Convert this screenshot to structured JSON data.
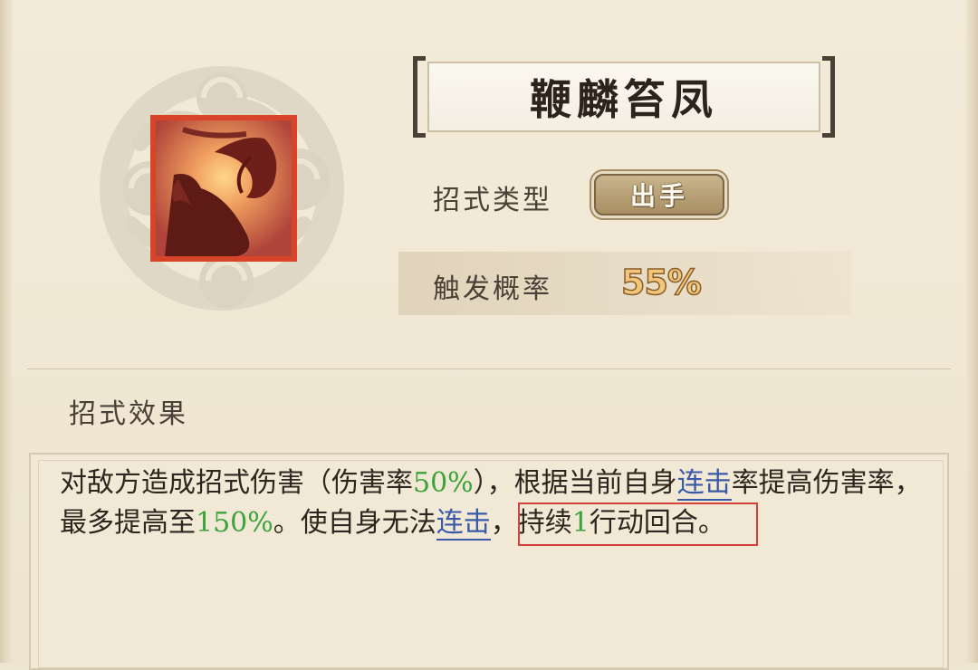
{
  "skill": {
    "name": "鞭麟笞凤",
    "icon": "dragon-phoenix-skill-icon"
  },
  "info": {
    "type_label": "招式类型",
    "type_value": "出手",
    "rate_label": "触发概率",
    "rate_value": "55%"
  },
  "effect": {
    "title": "招式效果",
    "seg1": "对敌方造成招式伤害（伤害率",
    "val1": "50%",
    "seg2": "），根据当前自身",
    "kw1": "连击",
    "seg3": "率提高伤害率，最多提高至",
    "val2": "150%",
    "seg4": "。",
    "seg5": "使自身无法",
    "kw2": "连击",
    "seg6": "，持续",
    "val3": "1",
    "seg7": "行动回合。"
  },
  "colors": {
    "value_green": "#3aa33a",
    "keyword_blue": "#3a5aa8",
    "icon_border_red": "#d8442a",
    "highlight_red": "#d5413a"
  }
}
